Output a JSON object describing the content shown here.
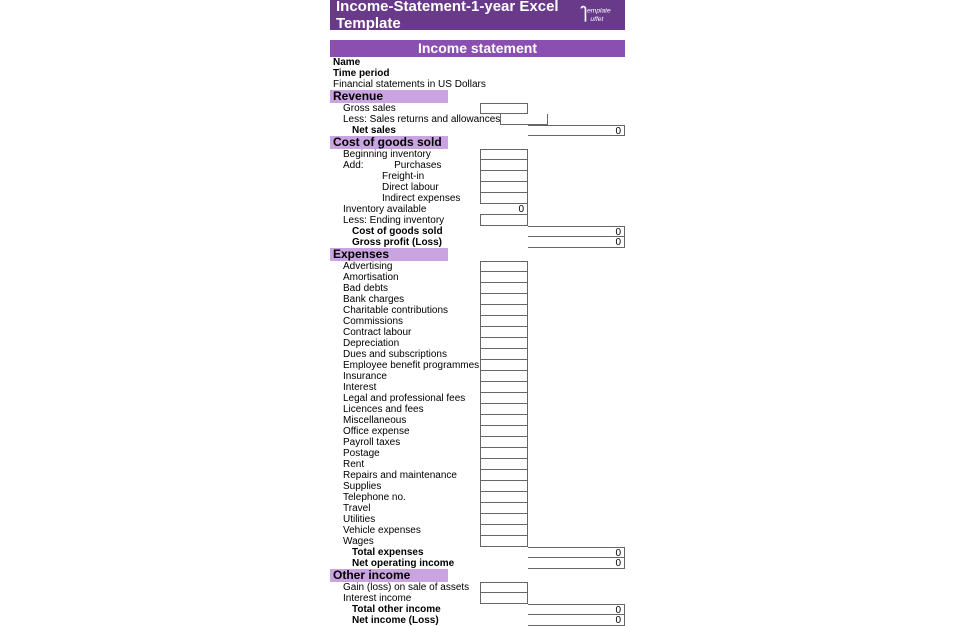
{
  "title_bar": "Income-Statement-1-year Excel Template",
  "logo_top": "emplate",
  "logo_bot": "uffet",
  "heading": "Income statement",
  "meta_name": "Name",
  "meta_period": "Time period",
  "meta_currency": "Financial statements in US Dollars",
  "sec_revenue": "Revenue",
  "gross_sales": "Gross sales",
  "less_returns": "Less: Sales returns and allowances",
  "net_sales": "Net sales",
  "net_sales_val": "0",
  "sec_cogs": "Cost of goods sold",
  "beg_inv": "Beginning inventory",
  "add_word": "Add:",
  "purchases": "Purchases",
  "freight": "Freight-in",
  "direct_labour": "Direct labour",
  "indirect_exp": "Indirect expenses",
  "inv_avail": "Inventory available",
  "inv_avail_val": "0",
  "less_end_inv": "Less: Ending inventory",
  "cogs_total": "Cost of goods sold",
  "cogs_total_val": "0",
  "gross_profit": "Gross profit (Loss)",
  "gross_profit_val": "0",
  "sec_exp": "Expenses",
  "exp": [
    "Advertising",
    "Amortisation",
    "Bad debts",
    "Bank charges",
    "Charitable contributions",
    "Commissions",
    "Contract labour",
    "Depreciation",
    "Dues and subscriptions",
    "Employee benefit programmes",
    "Insurance",
    "Interest",
    "Legal and professional fees",
    "Licences and fees",
    "Miscellaneous",
    "Office expense",
    "Payroll taxes",
    "Postage",
    "Rent",
    "Repairs and maintenance",
    "Supplies",
    "Telephone no.",
    "Travel",
    "Utilities",
    "Vehicle expenses",
    "Wages"
  ],
  "total_exp": "Total expenses",
  "total_exp_val": "0",
  "net_op": "Net operating income",
  "net_op_val": "0",
  "sec_other": "Other income",
  "gain_loss": "Gain (loss) on sale of assets",
  "int_income": "Interest income",
  "total_other": "Total other income",
  "total_other_val": "0",
  "net_income": "Net income (Loss)",
  "net_income_val": "0"
}
